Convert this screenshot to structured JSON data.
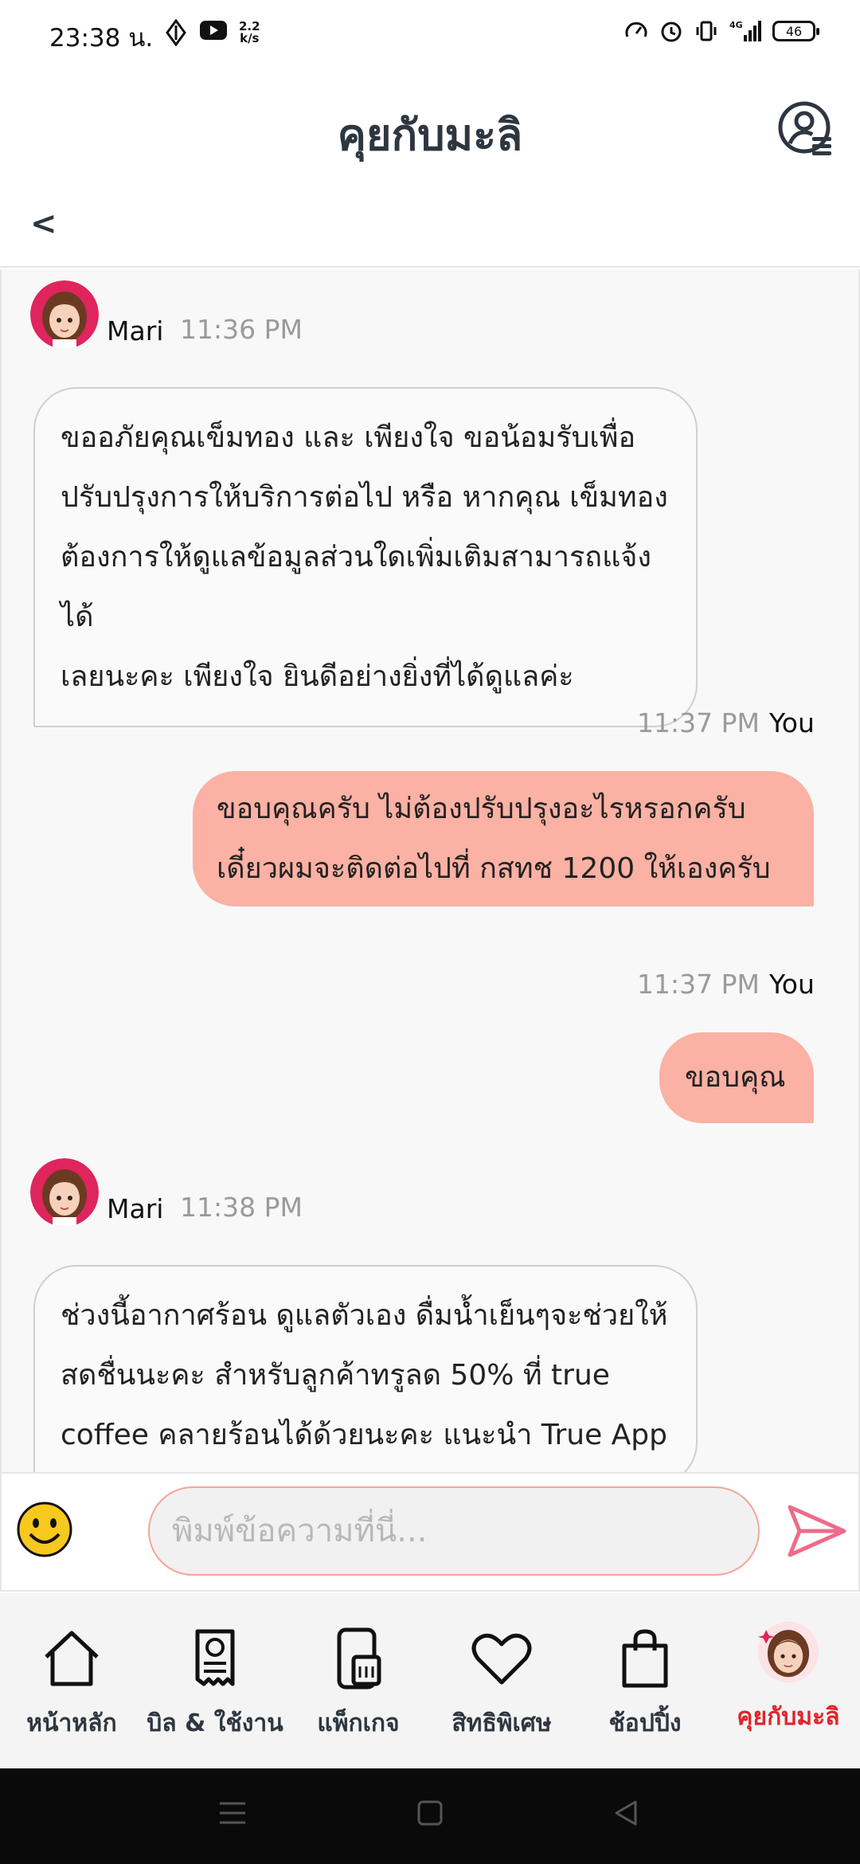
{
  "status_bar": {
    "time": "23:38 น.",
    "net_speed_value": "2.2",
    "net_speed_unit": "k/s",
    "battery": "46"
  },
  "header": {
    "title": "คุยกับมะลิ",
    "back_label": "<"
  },
  "messages": [
    {
      "sender": "Mari",
      "time": "11:36 PM",
      "lines": [
        "ขออภัยคุณเข็มทอง และ เพียงใจ ขอน้อมรับเพื่อ",
        "ปรับปรุงการให้บริการต่อไป หรือ หากคุณ เข็มทอง",
        "ต้องการให้ดูแลข้อมูลส่วนใดเพิ่มเติมสามารถแจ้งได้",
        "เลยนะคะ เพียงใจ ยินดีอย่างยิ่งที่ได้ดูแลค่ะ"
      ]
    },
    {
      "sender": "You",
      "time": "11:37 PM",
      "lines": [
        "ขอบคุณครับ ไม่ต้องปรับปรุงอะไรหรอกครับ",
        "เดี๋ยวผมจะติดต่อไปที่ กสทช 1200 ให้เองครับ"
      ]
    },
    {
      "sender": "You",
      "time": "11:37 PM",
      "lines": [
        "ขอบคุณ"
      ]
    },
    {
      "sender": "Mari",
      "time": "11:38 PM",
      "lines": [
        "ช่วงนี้อากาศร้อน ดูแลตัวเอง ดื่มน้ำเย็นๆจะช่วยให้",
        "สดชื่นนะคะ สำหรับลูกค้าทรูลด 50% ที่ true",
        "coffee คลายร้อนได้ด้วยนะคะ แนะนำ True App"
      ]
    }
  ],
  "input": {
    "placeholder": "พิมพ์ข้อความที่นี่..."
  },
  "bottom_nav": [
    {
      "label": "หน้าหลัก",
      "icon": "home-icon"
    },
    {
      "label": "บิล & ใช้งาน",
      "icon": "bill-icon"
    },
    {
      "label": "แพ็กเกจ",
      "icon": "package-sim-icon"
    },
    {
      "label": "สิทธิพิเศษ",
      "icon": "heart-icon"
    },
    {
      "label": "ช้อปปิ้ง",
      "icon": "shopping-bag-icon"
    },
    {
      "label": "คุยกับมะลิ",
      "icon": "mari-avatar-icon",
      "active": true
    }
  ],
  "colors": {
    "accent": "#e0242b",
    "outgoing_bubble": "#fbb1a3",
    "send_icon": "#f06a8a"
  }
}
